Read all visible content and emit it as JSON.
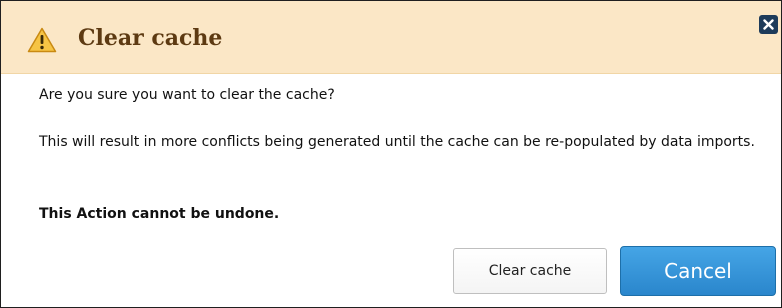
{
  "dialog": {
    "title": "Clear cache",
    "title_icon": "warning-icon",
    "close_icon": "close-icon",
    "message": "Are you sure you want to clear the cache?",
    "detail": "This will result in more conflicts being generated until the cache can be re-populated by data imports.",
    "warning": "This Action cannot be undone.",
    "buttons": {
      "confirm_label": "Clear cache",
      "cancel_label": "Cancel"
    }
  },
  "colors": {
    "titlebar_bg": "#fbe7c6",
    "title_text": "#5d3a12",
    "primary_button": "#2a86cc",
    "close_button": "#1d3b5a"
  }
}
